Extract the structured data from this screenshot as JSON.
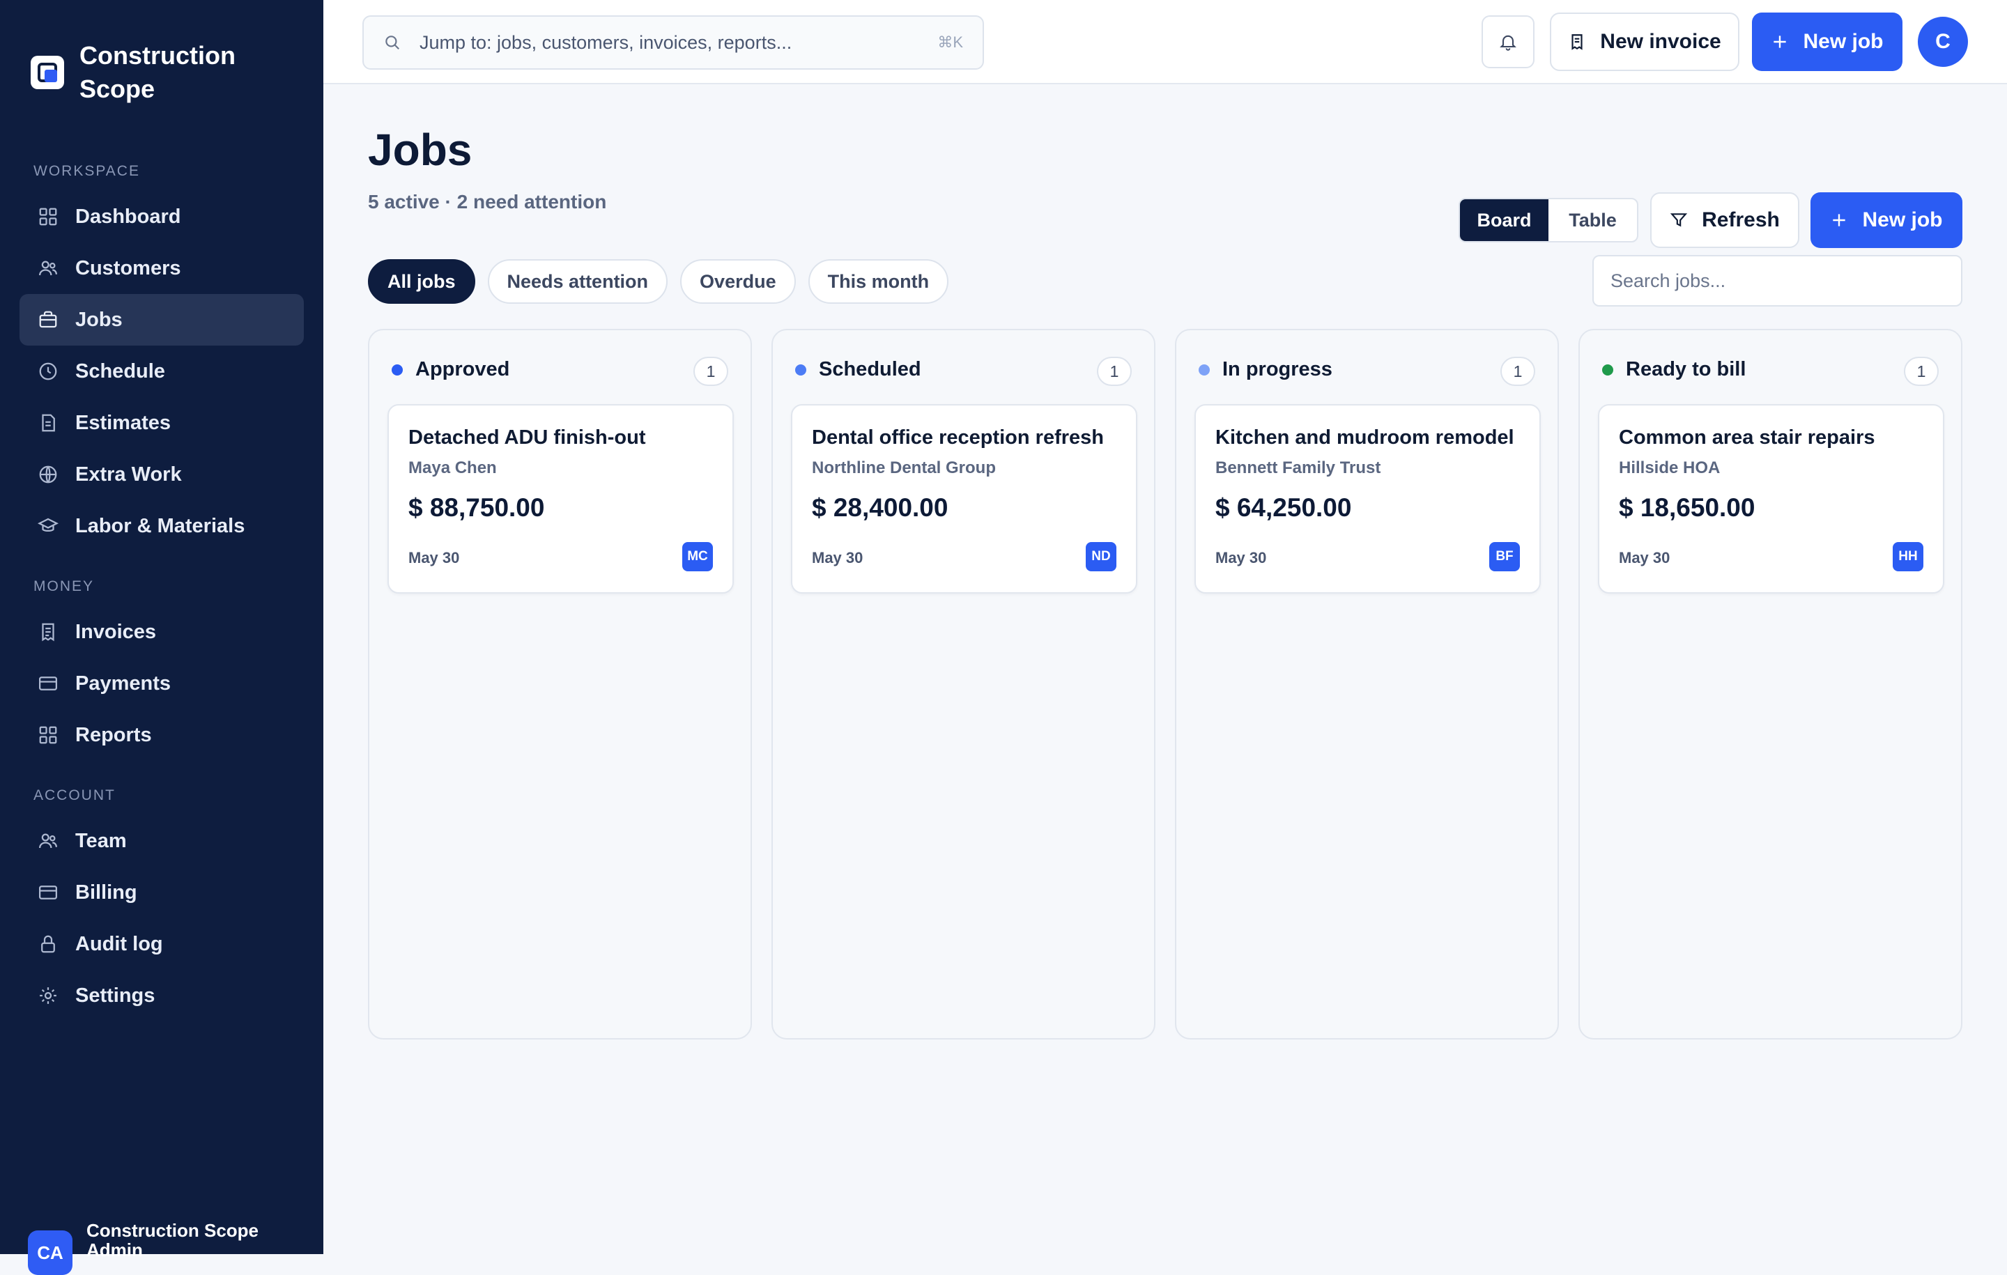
{
  "brand": {
    "name": "Construction Scope"
  },
  "sidebar": {
    "sections": [
      {
        "title": "WORKSPACE",
        "items": [
          {
            "label": "Dashboard",
            "icon": "grid-icon",
            "active": false
          },
          {
            "label": "Customers",
            "icon": "users-icon",
            "active": false
          },
          {
            "label": "Jobs",
            "icon": "briefcase-icon",
            "active": true
          },
          {
            "label": "Schedule",
            "icon": "clock-icon",
            "active": false
          },
          {
            "label": "Estimates",
            "icon": "document-icon",
            "active": false
          },
          {
            "label": "Extra Work",
            "icon": "globe-icon",
            "active": false
          },
          {
            "label": "Labor & Materials",
            "icon": "graduation-cap-icon",
            "active": false
          }
        ]
      },
      {
        "title": "MONEY",
        "items": [
          {
            "label": "Invoices",
            "icon": "receipt-icon",
            "active": false
          },
          {
            "label": "Payments",
            "icon": "credit-card-icon",
            "active": false
          },
          {
            "label": "Reports",
            "icon": "grid-icon",
            "active": false
          }
        ]
      },
      {
        "title": "ACCOUNT",
        "items": [
          {
            "label": "Team",
            "icon": "users-icon",
            "active": false
          },
          {
            "label": "Billing",
            "icon": "credit-card-icon",
            "active": false
          },
          {
            "label": "Audit log",
            "icon": "lock-icon",
            "active": false
          },
          {
            "label": "Settings",
            "icon": "gear-icon",
            "active": false
          }
        ]
      }
    ],
    "footer": {
      "initials": "CA",
      "name": "Construction Scope Admin"
    }
  },
  "topbar": {
    "search_placeholder": "Jump to: jobs, customers, invoices, reports...",
    "shortcut": "⌘K",
    "new_invoice_label": "New invoice",
    "new_job_label": "New job",
    "avatar_initial": "C"
  },
  "page": {
    "title": "Jobs",
    "subtitle": "5 active · 2 need attention",
    "view_toggle": [
      "Board",
      "Table"
    ],
    "active_view": "Board",
    "refresh_label": "Refresh",
    "new_job_label": "New job",
    "filters": [
      "All jobs",
      "Needs attention",
      "Overdue",
      "This month"
    ],
    "active_filter": "All jobs",
    "search_placeholder": "Search jobs..."
  },
  "columns": [
    {
      "title": "Approved",
      "count": "1",
      "dot_color": "#2b5cf3",
      "cards": [
        {
          "title": "Detached ADU finish-out",
          "client": "Maya Chen",
          "amount": "$ 88,750.00",
          "date": "May 30",
          "initials": "MC"
        }
      ]
    },
    {
      "title": "Scheduled",
      "count": "1",
      "dot_color": "#4c7cf5",
      "cards": [
        {
          "title": "Dental office reception refresh",
          "client": "Northline Dental Group",
          "amount": "$ 28,400.00",
          "date": "May 30",
          "initials": "ND"
        }
      ]
    },
    {
      "title": "In progress",
      "count": "1",
      "dot_color": "#7ea2f7",
      "cards": [
        {
          "title": "Kitchen and mudroom remodel",
          "client": "Bennett Family Trust",
          "amount": "$ 64,250.00",
          "date": "May 30",
          "initials": "BF"
        }
      ]
    },
    {
      "title": "Ready to bill",
      "count": "1",
      "dot_color": "#1f9a4b",
      "cards": [
        {
          "title": "Common area stair repairs",
          "client": "Hillside HOA",
          "amount": "$ 18,650.00",
          "date": "May 30",
          "initials": "HH"
        }
      ]
    }
  ],
  "colors": {
    "sidebar_bg": "#0e1d3f",
    "accent": "#2b5cf3",
    "page_bg": "#f5f7fb"
  }
}
